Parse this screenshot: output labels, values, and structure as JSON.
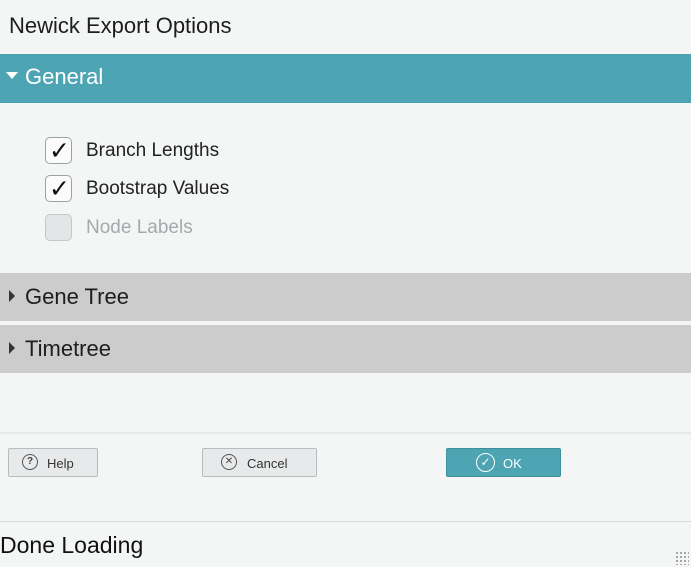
{
  "window": {
    "title": "Newick Export Options"
  },
  "sections": {
    "general": {
      "label": "General",
      "expanded": true,
      "options": [
        {
          "label": "Branch Lengths",
          "checked": true,
          "enabled": true
        },
        {
          "label": "Bootstrap Values",
          "checked": true,
          "enabled": true
        },
        {
          "label": "Node Labels",
          "checked": false,
          "enabled": false
        }
      ]
    },
    "gene_tree": {
      "label": "Gene Tree",
      "expanded": false
    },
    "timetree": {
      "label": "Timetree",
      "expanded": false
    }
  },
  "buttons": {
    "help": {
      "label": "Help",
      "icon": "help-icon"
    },
    "cancel": {
      "label": "Cancel",
      "icon": "close-icon"
    },
    "ok": {
      "label": "OK",
      "icon": "check-circle-icon"
    }
  },
  "status": {
    "text": "Done Loading"
  },
  "colors": {
    "accent": "#4da5b3",
    "collapsed_header": "#cccccc",
    "background": "#f4f6f6"
  }
}
